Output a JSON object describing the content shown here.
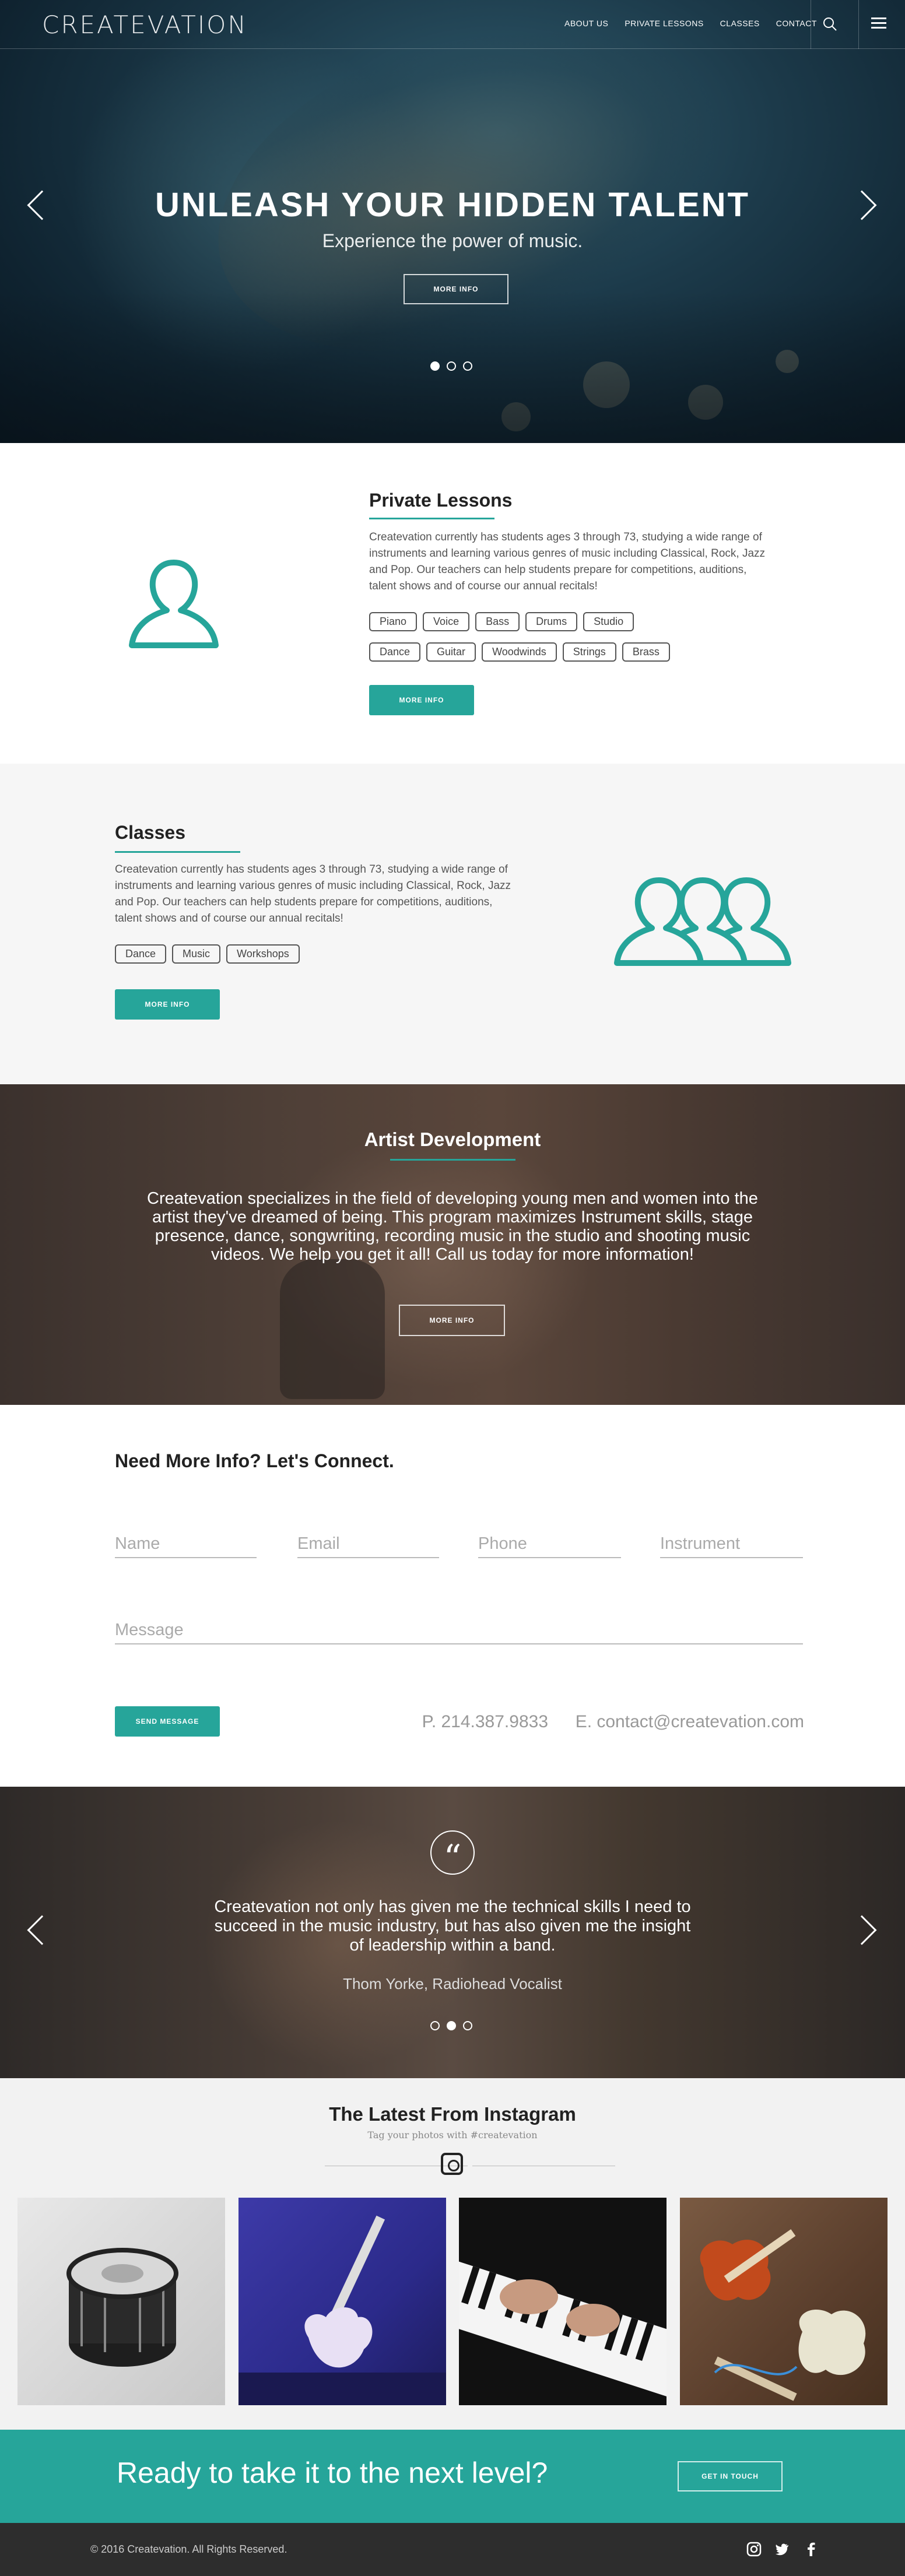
{
  "brand": {
    "logo": "CREATEVATION"
  },
  "nav": {
    "links": [
      "ABOUT US",
      "PRIVATE LESSONS",
      "CLASSES",
      "CONTACT"
    ],
    "search_icon": "search-icon",
    "menu_icon": "hamburger-menu-icon"
  },
  "hero": {
    "title": "UNLEASH YOUR HIDDEN TALENT",
    "subtitle": "Experience the power of music.",
    "button": "MORE INFO",
    "slide_count": 3,
    "active_slide": 1
  },
  "lessons": {
    "title": "Private Lessons",
    "description": "Createvation currently has students ages 3 through 73, studying a wide range of instruments and learning various genres of music including Classical, Rock, Jazz and Pop.  Our teachers can help students prepare for competitions, auditions, talent shows and of course our annual recitals!",
    "tags_row1": [
      "Piano",
      "Voice",
      "Bass",
      "Drums",
      "Studio"
    ],
    "tags_row2": [
      "Dance",
      "Guitar",
      "Woodwinds",
      "Strings",
      "Brass"
    ],
    "button": "MORE INFO",
    "icon": "person-icon"
  },
  "classes": {
    "title": "Classes",
    "description": "Createvation currently has students ages 3 through 73, studying a wide range of instruments and learning various genres of music including Classical, Rock, Jazz and Pop.  Our teachers can help students prepare for competitions, auditions, talent shows and of course our annual recitals!",
    "tags": [
      "Dance",
      "Music",
      "Workshops"
    ],
    "button": "MORE INFO",
    "icon": "group-icon"
  },
  "artist": {
    "title": "Artist Development",
    "description": "Createvation specializes in the field of developing young men and women into the artist they've dreamed of being.  This program maximizes Instrument skills, stage presence, dance, songwriting, recording music in the studio and shooting music videos. We help you get it all! Call us today for more information!",
    "button": "MORE INFO"
  },
  "contact": {
    "title": "Need More Info?  Let's Connect.",
    "fields": {
      "name": "Name",
      "email": "Email",
      "phone": "Phone",
      "instrument": "Instrument",
      "message": "Message"
    },
    "button": "SEND MESSAGE",
    "phone": "P. 214.387.9833",
    "email": "E.  contact@createvation.com"
  },
  "testimonial": {
    "quote_mark": "“",
    "quote": "Createvation not only has given me the technical skills I need to succeed in the music industry, but has also given me the insight of leadership within a band.",
    "author": "Thom Yorke, Radiohead Vocalist",
    "slide_count": 3,
    "active_slide": 2
  },
  "instagram": {
    "title": "The Latest From Instagram",
    "subtitle": "Tag your photos with #createvation",
    "icon": "instagram-icon",
    "photos": [
      "snare-drum-photo",
      "electric-guitar-photo",
      "piano-photo",
      "bass-guitars-photo"
    ]
  },
  "cta": {
    "text": "Ready to take it to the next level?",
    "button": "GET IN TOUCH"
  },
  "footer": {
    "copyright": "© 2016 Createvation. All Rights Reserved.",
    "social": [
      "instagram-icon",
      "twitter-icon",
      "facebook-icon"
    ]
  },
  "colors": {
    "accent": "#26a59a",
    "footer": "#2d2d2d",
    "light_bg": "#f6f6f6"
  }
}
